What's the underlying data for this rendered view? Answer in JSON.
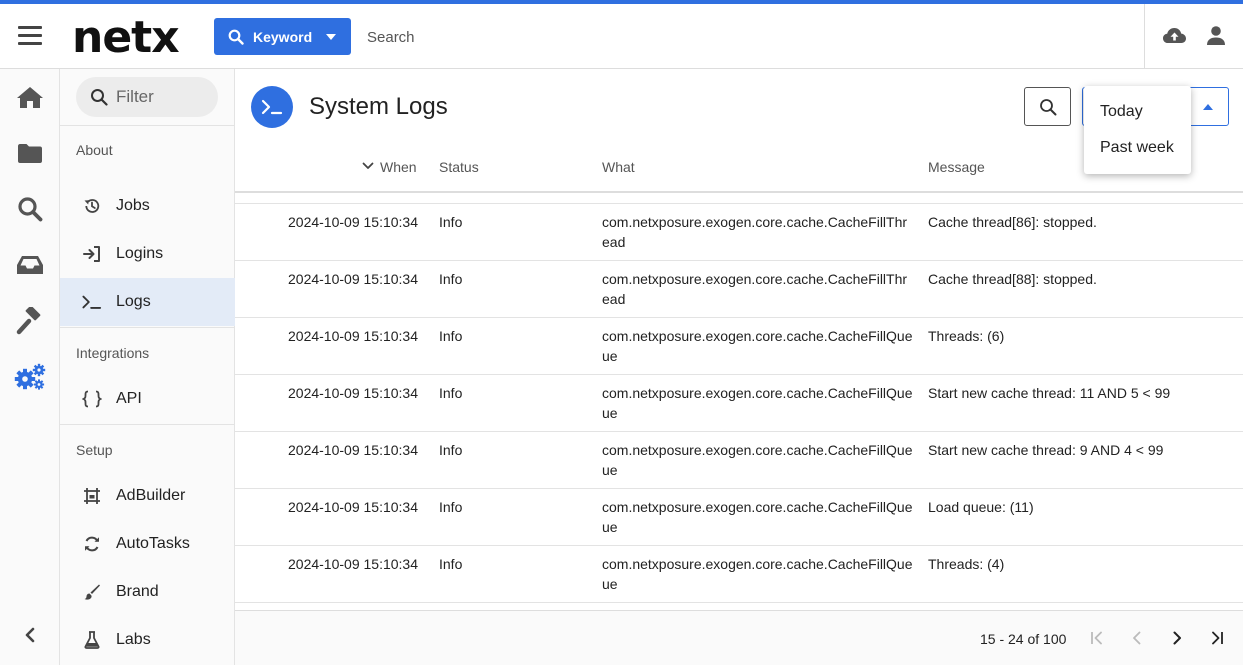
{
  "app": {
    "logo_text": "netx"
  },
  "topbar": {
    "keyword_label": "Keyword",
    "search_placeholder": "Search"
  },
  "sidebar": {
    "filter_placeholder": "Filter",
    "sections": {
      "about": "About",
      "integrations": "Integrations",
      "setup": "Setup"
    },
    "items": [
      {
        "label": "Jobs",
        "icon": "history-icon"
      },
      {
        "label": "Logins",
        "icon": "login-icon"
      },
      {
        "label": "Logs",
        "icon": "terminal-icon",
        "active": true
      },
      {
        "label": "API",
        "icon": "braces-icon"
      },
      {
        "label": "AdBuilder",
        "icon": "adbuilder-icon"
      },
      {
        "label": "AutoTasks",
        "icon": "sync-icon"
      },
      {
        "label": "Brand",
        "icon": "brush-icon"
      },
      {
        "label": "Labs",
        "icon": "flask-icon"
      }
    ]
  },
  "main": {
    "page_title": "System Logs",
    "range_dropdown": {
      "options": [
        "Today",
        "Past week"
      ]
    },
    "table": {
      "columns": {
        "when": "When",
        "status": "Status",
        "what": "What",
        "message": "Message"
      },
      "rows": [
        {
          "when": "2024-10-09 15:10:34",
          "status": "Info",
          "what": "com.netxposure.exogen.core.cache.CacheFillThread",
          "message": "Cache thread[86]: stopped."
        },
        {
          "when": "2024-10-09 15:10:34",
          "status": "Info",
          "what": "com.netxposure.exogen.core.cache.CacheFillThread",
          "message": "Cache thread[88]: stopped."
        },
        {
          "when": "2024-10-09 15:10:34",
          "status": "Info",
          "what": "com.netxposure.exogen.core.cache.CacheFillQueue",
          "message": "Threads: (6)"
        },
        {
          "when": "2024-10-09 15:10:34",
          "status": "Info",
          "what": "com.netxposure.exogen.core.cache.CacheFillQueue",
          "message": "Start new cache thread: 11 AND 5 < 99"
        },
        {
          "when": "2024-10-09 15:10:34",
          "status": "Info",
          "what": "com.netxposure.exogen.core.cache.CacheFillQueue",
          "message": "Start new cache thread: 9 AND 4 < 99"
        },
        {
          "when": "2024-10-09 15:10:34",
          "status": "Info",
          "what": "com.netxposure.exogen.core.cache.CacheFillQueue",
          "message": "Load queue: (11)"
        },
        {
          "when": "2024-10-09 15:10:34",
          "status": "Info",
          "what": "com.netxposure.exogen.core.cache.CacheFillQueue",
          "message": "Threads: (4)"
        }
      ]
    },
    "pagination": {
      "range_text": "15 - 24 of 100"
    }
  },
  "colors": {
    "accent": "#2f6fe0",
    "active_item_bg": "#e3ebf7"
  }
}
